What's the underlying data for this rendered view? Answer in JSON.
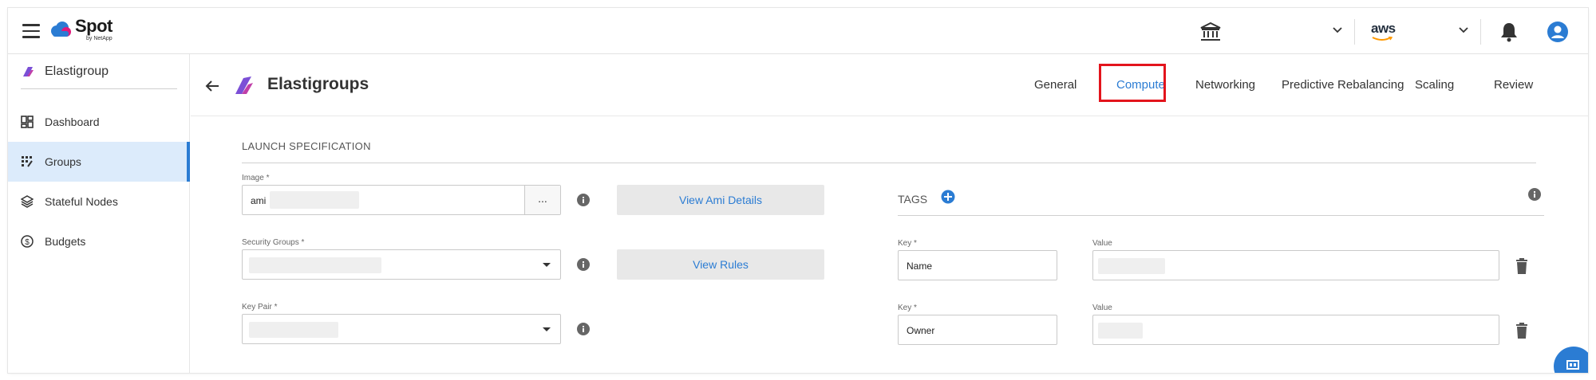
{
  "topbar": {
    "logo_main": "Spot",
    "logo_sub": "by NetApp",
    "account_icon": "bank-icon",
    "cloud_provider": "aws"
  },
  "sidebar": {
    "header": "Elastigroup",
    "items": [
      {
        "label": "Dashboard",
        "icon": "dashboard-icon"
      },
      {
        "label": "Groups",
        "icon": "groups-icon",
        "active": true
      },
      {
        "label": "Stateful Nodes",
        "icon": "layers-icon"
      },
      {
        "label": "Budgets",
        "icon": "dollar-icon"
      }
    ]
  },
  "header": {
    "title": "Elastigroups",
    "tabs": [
      {
        "label": "General"
      },
      {
        "label": "Compute",
        "active": true
      },
      {
        "label": "Networking"
      },
      {
        "label": "Predictive Rebalancing"
      },
      {
        "label": "Scaling"
      },
      {
        "label": "Review"
      }
    ]
  },
  "form": {
    "section_title": "LAUNCH SPECIFICATION",
    "image_label": "Image *",
    "image_value": "ami",
    "image_browse": "...",
    "security_groups_label": "Security Groups *",
    "key_pair_label": "Key Pair *",
    "view_ami_details": "View Ami Details",
    "view_rules": "View Rules"
  },
  "tags": {
    "title": "TAGS",
    "rows": [
      {
        "key_label": "Key *",
        "key": "Name",
        "value_label": "Value"
      },
      {
        "key_label": "Key *",
        "key": "Owner",
        "value_label": "Value"
      }
    ]
  },
  "colors": {
    "accent": "#2b7cd3",
    "highlight": "#e3141c",
    "active_bg": "#dcebfb"
  }
}
